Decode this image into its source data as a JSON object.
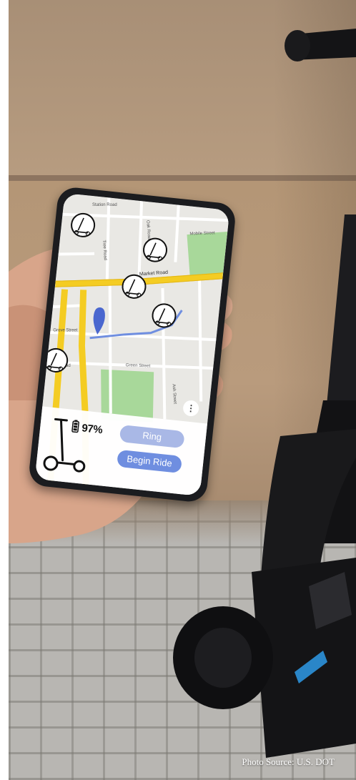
{
  "map": {
    "streets": [
      "Market Road",
      "Mobile Street",
      "Station Road",
      "Oak Road",
      "Tree Road",
      "Green Street",
      "West Road",
      "Grove Street",
      "Ash Street"
    ]
  },
  "panel": {
    "battery_level": "97%",
    "ring_label": "Ring",
    "begin_ride_label": "Begin Ride",
    "menu_icon": "more-dots-icon"
  },
  "credit": "Photo Source: U.S. DOT",
  "colors": {
    "main_road": "#f4cc23",
    "route": "#6f8ee0",
    "location_pin": "#4a67cf",
    "park": "#a8d89a",
    "ring_button": "#a9b8e6",
    "begin_button": "#6f8ee0"
  }
}
